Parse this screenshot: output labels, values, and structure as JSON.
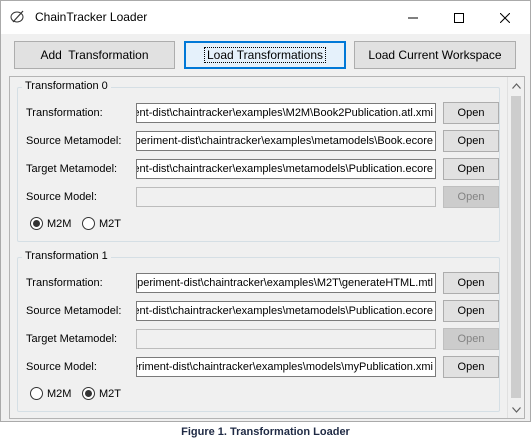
{
  "window": {
    "title": "ChainTracker Loader",
    "icon": "chaintracker-app-icon",
    "controls": [
      "minimize-icon",
      "maximize-icon",
      "close-icon"
    ]
  },
  "toolbar": {
    "add_label": "Add  Transformation",
    "load_label": "Load Transformations",
    "workspace_label": "Load Current Workspace"
  },
  "labels": {
    "transformation": "Transformation:",
    "source_metamodel": "Source Metamodel:",
    "target_metamodel": "Target Metamodel:",
    "source_model": "Source Model:",
    "open": "Open",
    "m2m": "M2M",
    "m2t": "M2T"
  },
  "transformations": [
    {
      "title": "Transformation 0",
      "transformation": "ent-dist\\chaintracker\\examples\\M2M\\Book2Publication.atl.xmi",
      "source_metamodel": "periment-dist\\chaintracker\\examples\\metamodels\\Book.ecore",
      "target_metamodel": "ent-dist\\chaintracker\\examples\\metamodels\\Publication.ecore",
      "source_model": "",
      "type_selected": "M2M"
    },
    {
      "title": "Transformation 1",
      "transformation": "periment-dist\\chaintracker\\examples\\M2T\\generateHTML.mtl",
      "source_metamodel": "ent-dist\\chaintracker\\examples\\metamodels\\Publication.ecore",
      "target_metamodel": "",
      "source_model": "eriment-dist\\chaintracker\\examples\\models\\myPublication.xmi",
      "type_selected": "M2T"
    }
  ],
  "caption": "Figure 1. Transformation Loader"
}
